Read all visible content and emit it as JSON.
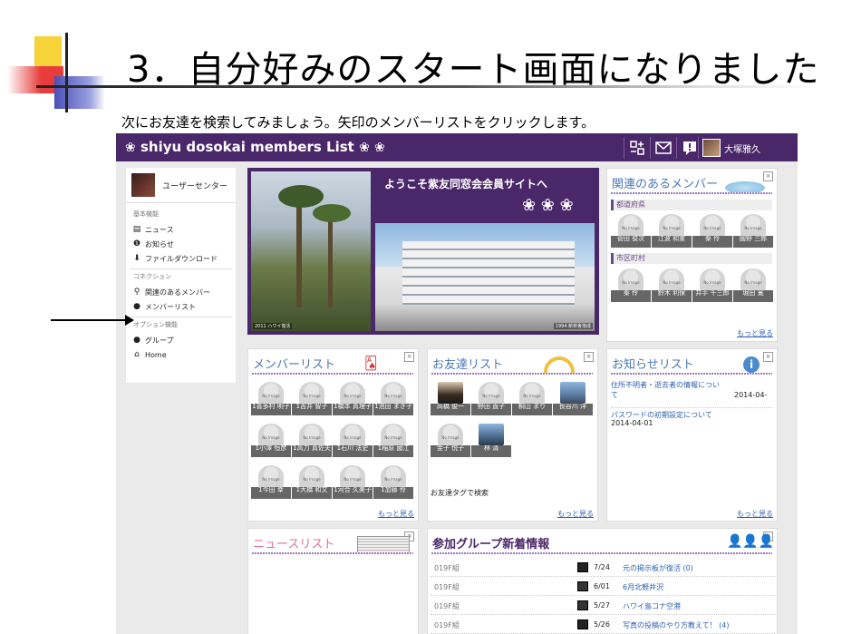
{
  "slide": {
    "title": "3．自分好みのスタート画面になりました",
    "instruction": "次にお友達を検索してみましょう。矢印のメンバーリストをクリックします。"
  },
  "topbar": {
    "brand": "shiyu dosokai members List",
    "flower_glyph": "❀",
    "user_name": "大塚雅久",
    "icons": [
      "grid-icon",
      "mail-icon",
      "alert-icon"
    ]
  },
  "sidebar": {
    "user_center": "ユーザーセンター",
    "sections": [
      {
        "label": "基本機能",
        "items": [
          {
            "label": "ニュース",
            "icon": "news-icon"
          },
          {
            "label": "お知らせ",
            "icon": "info-icon"
          },
          {
            "label": "ファイルダウンロード",
            "icon": "download-icon"
          }
        ]
      },
      {
        "label": "コネクション",
        "items": [
          {
            "label": "関連のあるメンバー",
            "icon": "search-icon"
          },
          {
            "label": "メンバーリスト",
            "icon": "person-icon"
          }
        ]
      },
      {
        "label": "オプション機能",
        "items": [
          {
            "label": "グループ",
            "icon": "group-icon"
          },
          {
            "label": "Home",
            "icon": "home-icon"
          }
        ]
      }
    ]
  },
  "banner": {
    "welcome": "ようこそ紫友同窓会会員サイトへ",
    "caption_left": "2011 ハワイ復活",
    "caption_right": "1994 新校舎落成"
  },
  "related_members": {
    "title": "関連のあるメンバー",
    "prefecture_label": "都道府県",
    "city_label": "市区町村",
    "no_image": "No Image",
    "prefecture_members": [
      "菅田 俊次",
      "江波 和重",
      "秦 伶",
      "國野 三郎"
    ],
    "city_members": [
      "秦 伶",
      "鈴木 利保",
      "井手 千三郎",
      "堀田 寛"
    ],
    "more": "もっと見る"
  },
  "member_list": {
    "title": "メンバーリスト",
    "no_image": "No Image",
    "members": [
      "1喜多村 明子",
      "1吉井 智子",
      "1橋本 真理子",
      "1池田 まき子",
      "1小澤 恒彦",
      "1高力 真佐夫",
      "1石川 法史",
      "1稲原 國江",
      "1今田 幸",
      "1大橋 和文",
      "1河合 久美子",
      "1加藤 伶"
    ],
    "more": "もっと見る"
  },
  "friend_list": {
    "title": "お友達リスト",
    "no_image": "No Image",
    "friends": [
      "高橋 俊一",
      "野田 直子",
      "桐山 まり",
      "長谷川 洋",
      "金子 悦子",
      "林 清"
    ],
    "tag_search": "お友達タグで検索",
    "more": "もっと見る"
  },
  "notice_list": {
    "title": "お知らせリスト",
    "items": [
      {
        "title": "住所不明者・逝去者の情報について",
        "date": "2014-04-"
      },
      {
        "title": "パスワードの初期設定について",
        "date": "2014-04-01"
      }
    ],
    "more": "もっと見る"
  },
  "news_list": {
    "title": "ニュースリスト"
  },
  "group_news": {
    "title": "参加グループ新着情報",
    "rows": [
      {
        "group": "019F組",
        "icon": "comment-icon",
        "date": "7/24",
        "text": "元の掲示板が復活 (0)"
      },
      {
        "group": "019F組",
        "icon": "photo-icon",
        "date": "6/01",
        "text": "6月北軽井沢"
      },
      {
        "group": "019F組",
        "icon": "photo-icon",
        "date": "5/27",
        "text": "ハワイ島コナ空港"
      },
      {
        "group": "019F組",
        "icon": "comment-icon",
        "date": "5/26",
        "text": "写真の投稿のやり方教えて！ (4)"
      }
    ]
  }
}
